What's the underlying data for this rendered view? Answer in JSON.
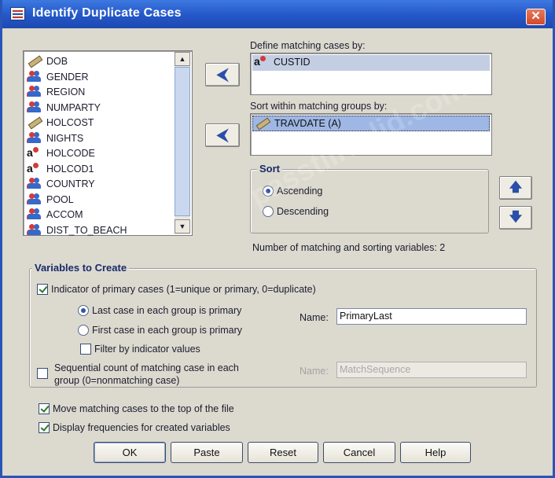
{
  "window": {
    "title": "Identify Duplicate Cases",
    "close_glyph": "✕"
  },
  "variables": [
    {
      "name": "DOB",
      "type": "scale"
    },
    {
      "name": "GENDER",
      "type": "nominal"
    },
    {
      "name": "REGION",
      "type": "nominal"
    },
    {
      "name": "NUMPARTY",
      "type": "nominal"
    },
    {
      "name": "HOLCOST",
      "type": "scale"
    },
    {
      "name": "NIGHTS",
      "type": "nominal"
    },
    {
      "name": "HOLCODE",
      "type": "string"
    },
    {
      "name": "HOLCOD1",
      "type": "string"
    },
    {
      "name": "COUNTRY",
      "type": "nominal"
    },
    {
      "name": "POOL",
      "type": "nominal"
    },
    {
      "name": "ACCOM",
      "type": "nominal"
    },
    {
      "name": "DIST_TO_BEACH",
      "type": "nominal"
    }
  ],
  "move_arrow_glyph": "⮜",
  "matching": {
    "label": "Define matching cases by:",
    "items": [
      "CUSTID"
    ]
  },
  "sorting": {
    "label": "Sort within matching groups by:",
    "items": [
      "TRAVDATE (A)"
    ]
  },
  "sort_group": {
    "title": "Sort",
    "ascending": "Ascending",
    "descending": "Descending",
    "selected": "ascending"
  },
  "reorder": {
    "up_glyph": "🡅",
    "down_glyph": "🡇"
  },
  "count_text": "Number of matching and sorting variables: 2",
  "variables_to_create": {
    "title": "Variables to Create",
    "indicator_label": "Indicator of primary cases (1=unique or primary, 0=duplicate)",
    "indicator_checked": true,
    "last_case": "Last case in each group is primary",
    "first_case": "First case in each group is primary",
    "primary_selected": "last",
    "filter_label": "Filter by indicator values",
    "filter_checked": false,
    "name_label": "Name:",
    "name_value": "PrimaryLast",
    "sequential_label_1": "Sequential count of matching case in each",
    "sequential_label_2": "group (0=nonmatching case)",
    "sequential_checked": false,
    "seq_name_label": "Name:",
    "seq_name_value": "MatchSequence"
  },
  "move_to_top": {
    "label": "Move matching cases to the top of the file",
    "checked": true
  },
  "display_freq": {
    "label": "Display frequencies for created variables",
    "checked": true
  },
  "buttons": {
    "ok": "OK",
    "paste": "Paste",
    "reset": "Reset",
    "cancel": "Cancel",
    "help": "Help"
  },
  "watermark": "passtillvalid.com"
}
